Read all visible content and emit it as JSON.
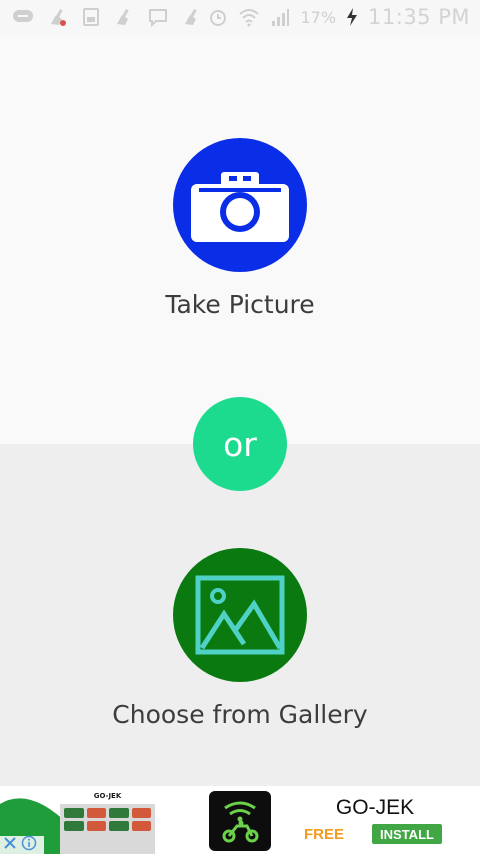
{
  "status_bar": {
    "battery_percent": "17%",
    "time": "11:35 PM",
    "icons": [
      "messaging-icon",
      "cleaner-icon",
      "gallery-icon",
      "cleaner-icon",
      "chat-icon",
      "cleaner-icon",
      "alarm-icon",
      "wifi-icon",
      "signal-icon",
      "charging-icon"
    ]
  },
  "main": {
    "take_picture": {
      "label": "Take Picture",
      "icon": "camera-icon",
      "color": "#0a2ee8"
    },
    "or_label": "or",
    "or_color": "#1ddb8e",
    "choose_gallery": {
      "label": "Choose from Gallery",
      "icon": "gallery-image-icon",
      "color": "#0a7a10"
    }
  },
  "ad": {
    "brand": "GO-JEK",
    "phone_header": "GO-JEK",
    "price": "FREE",
    "install_label": "INSTALL",
    "icons": [
      "close-icon",
      "info-icon",
      "scooter-rider-icon"
    ]
  }
}
